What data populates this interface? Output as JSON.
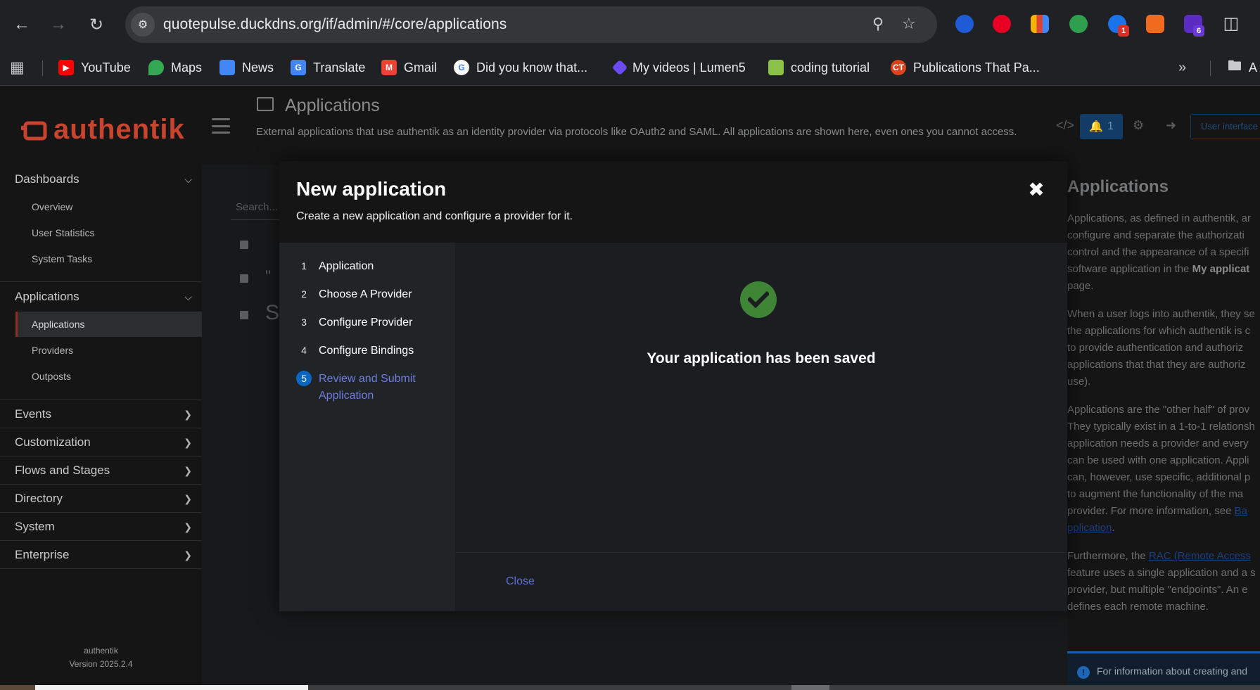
{
  "browser": {
    "url": "quotepulse.duckdns.org/if/admin/#/core/applications",
    "extension_badges": [
      "1",
      "6"
    ],
    "bookmarks": [
      {
        "label": "YouTube",
        "color": "#ff0000"
      },
      {
        "label": "Maps",
        "color": "#34a853"
      },
      {
        "label": "News",
        "color": "#4285f4"
      },
      {
        "label": "Translate",
        "color": "#4285f4"
      },
      {
        "label": "Gmail",
        "color": "#ea4335"
      },
      {
        "label": "Did you know that...",
        "color": "#ffffff"
      },
      {
        "label": "My videos | Lumen5",
        "color": "#6c4bf5"
      },
      {
        "label": "coding tutorial",
        "color": "#8bc34a"
      },
      {
        "label": "Publications That Pa...",
        "color": "#d9441c"
      }
    ],
    "bookmarks_folder": "A"
  },
  "app": {
    "logo_text": "authentik",
    "brand_color": "#c7442f",
    "page_title": "Applications",
    "page_description": "External applications that use authentik as an identity provider via protocols like OAuth2 and SAML. All applications are shown here, even ones you cannot access.",
    "notification_count": "1",
    "user_interface_label": "User interface",
    "search_placeholder": "Search...",
    "row_text_quote": "\"",
    "row_text_s": "S"
  },
  "sidebar": {
    "dashboards": {
      "label": "Dashboards",
      "items": [
        "Overview",
        "User Statistics",
        "System Tasks"
      ]
    },
    "applications": {
      "label": "Applications",
      "items": [
        "Applications",
        "Providers",
        "Outposts"
      ]
    },
    "sections": [
      "Events",
      "Customization",
      "Flows and Stages",
      "Directory",
      "System",
      "Enterprise"
    ],
    "footer_name": "authentik",
    "footer_version": "Version 2025.2.4"
  },
  "modal": {
    "title": "New application",
    "subtitle": "Create a new application and configure a provider for it.",
    "steps": [
      {
        "num": "1",
        "label": "Application"
      },
      {
        "num": "2",
        "label": "Choose A Provider"
      },
      {
        "num": "3",
        "label": "Configure Provider"
      },
      {
        "num": "4",
        "label": "Configure Bindings"
      },
      {
        "num": "5",
        "label": "Review and Submit Application"
      }
    ],
    "success_message": "Your application has been saved",
    "close_label": "Close",
    "success_color": "#3e8635"
  },
  "help": {
    "title": "Applications",
    "p1": [
      "Applications, as defined in authentik, ar",
      "configure and separate the authorizati",
      "control and the appearance of a specifi",
      "software application in the ",
      "My applicat",
      "page."
    ],
    "p2": [
      "When a user logs into authentik, they se",
      "the applications for which authentik is c",
      "to provide authentication and authoriz",
      "applications that that they are authoriz",
      "use)."
    ],
    "p3": [
      "Applications are the \"other half\" of prov",
      "They typically exist in a 1-to-1 relationsh",
      "application needs a provider and every",
      "can be used with one application. Appli",
      "can, however, use specific, additional p",
      "to augment the functionality of the ma",
      "provider. For more information, see ",
      "Ba",
      "pplication",
      "."
    ],
    "p4": [
      "Furthermore, the ",
      "RAC (Remote Access",
      "feature uses a single application and a s",
      "provider, but multiple \"endpoints\". An e",
      "defines each remote machine."
    ],
    "alert": "For information about creating and"
  }
}
